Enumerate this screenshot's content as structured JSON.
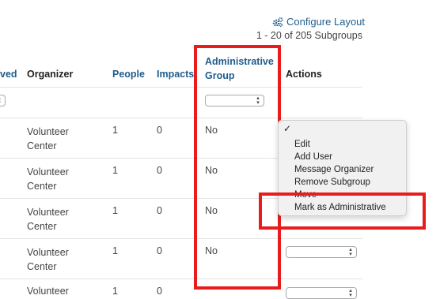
{
  "header": {
    "configure_label": "Configure Layout",
    "pagination": "1 - 20 of 205 Subgroups"
  },
  "columns": {
    "approved_partial": "ved",
    "organizer": "Organizer",
    "people": "People",
    "impacts_partial": "Impacts",
    "admin_line1": "Administrative",
    "admin_line2": "Group",
    "actions": "Actions"
  },
  "rows": [
    {
      "organizer_line1": "Volunteer",
      "organizer_line2": "Center",
      "people": "1",
      "impacts": "0",
      "admin": "No"
    },
    {
      "organizer_line1": "Volunteer",
      "organizer_line2": "Center",
      "people": "1",
      "impacts": "0",
      "admin": "No"
    },
    {
      "organizer_line1": "Volunteer",
      "organizer_line2": "Center",
      "people": "1",
      "impacts": "0",
      "admin": "No"
    },
    {
      "organizer_line1": "Volunteer",
      "organizer_line2": "Center",
      "people": "1",
      "impacts": "0",
      "admin": "No"
    },
    {
      "organizer_line1": "Volunteer",
      "people": "1",
      "impacts": "0"
    }
  ],
  "actions_menu": {
    "checkmark": "✓",
    "items": [
      "Edit",
      "Add User",
      "Message Organizer",
      "Remove Subgroup",
      "Move",
      "Mark as Administrative"
    ]
  },
  "colors": {
    "link_blue": "#1f5d8c",
    "highlight_red": "#e81c1c"
  },
  "icons": {
    "configure": "gears-icon",
    "select": "chevron-up-down-icon",
    "menu_selected": "check-icon"
  }
}
